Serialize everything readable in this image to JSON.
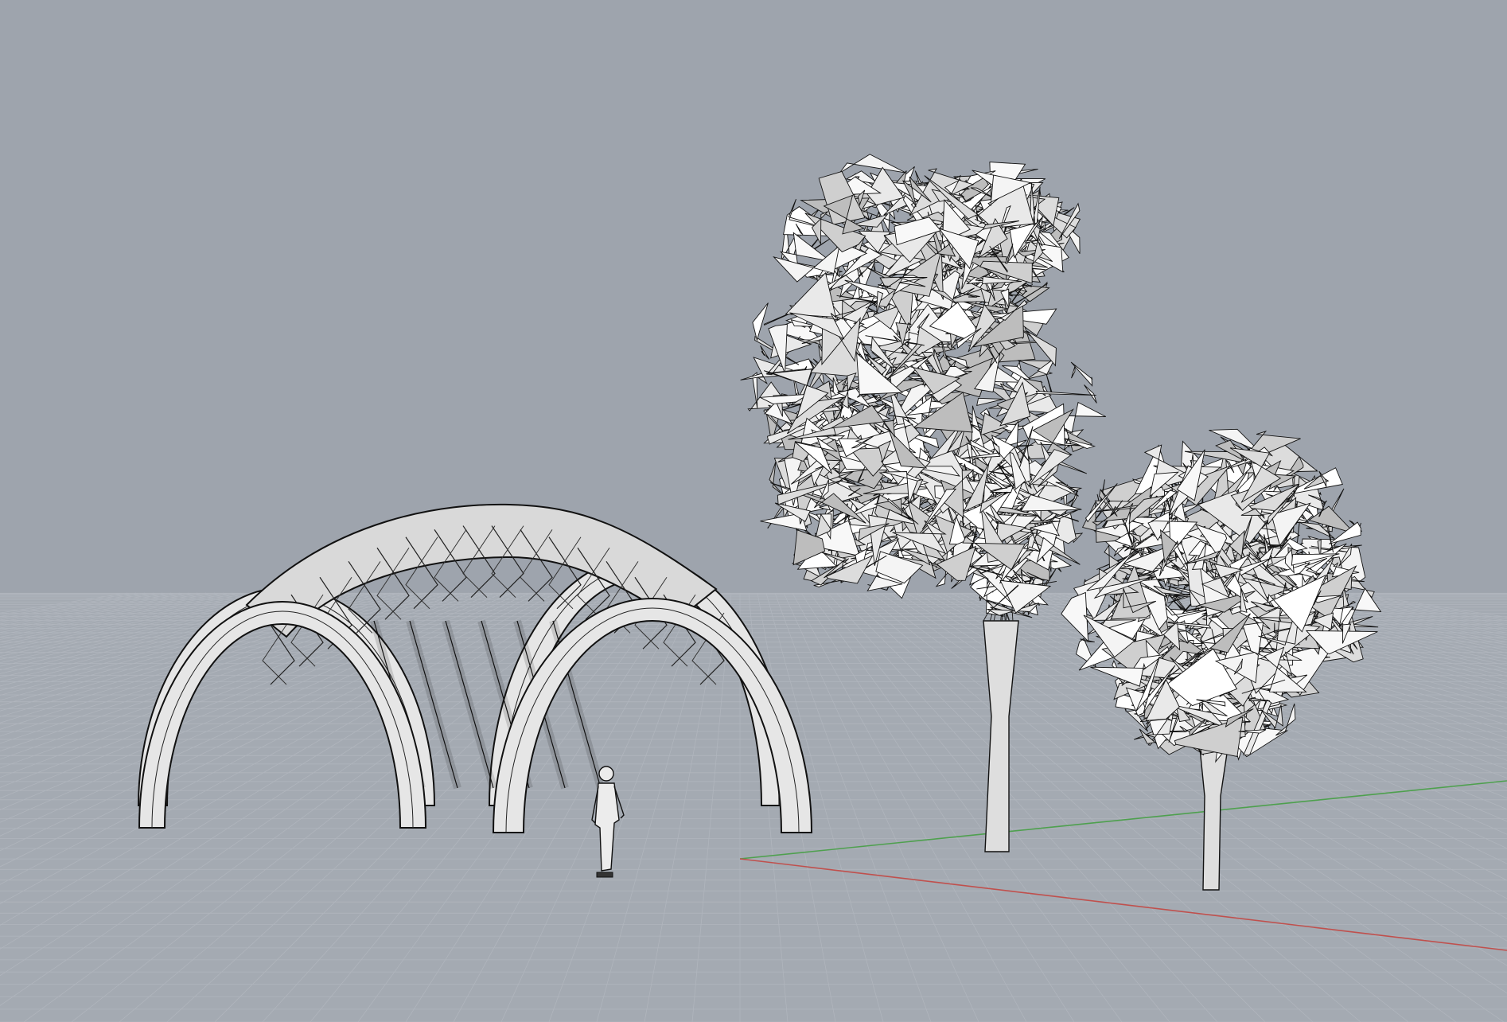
{
  "viewport": {
    "view": "perspective",
    "display_mode": "shaded",
    "background": "#9ea4ad",
    "grid": "on",
    "grid_color": "#b3b8bf",
    "x_axis_color": "#c0504d",
    "y_axis_color": "#4ea04e"
  },
  "scene": {
    "objects": [
      {
        "name": "vault-pavilion",
        "kind": "ribbed twin-arch vault",
        "fill": "#e6e6e6"
      },
      {
        "name": "human-figure",
        "kind": "scale figure",
        "fill": "#ececec"
      },
      {
        "name": "tree-large",
        "kind": "low-poly tree",
        "fill": "#f0f0f0"
      },
      {
        "name": "tree-small",
        "kind": "low-poly tree",
        "fill": "#f0f0f0"
      }
    ]
  }
}
